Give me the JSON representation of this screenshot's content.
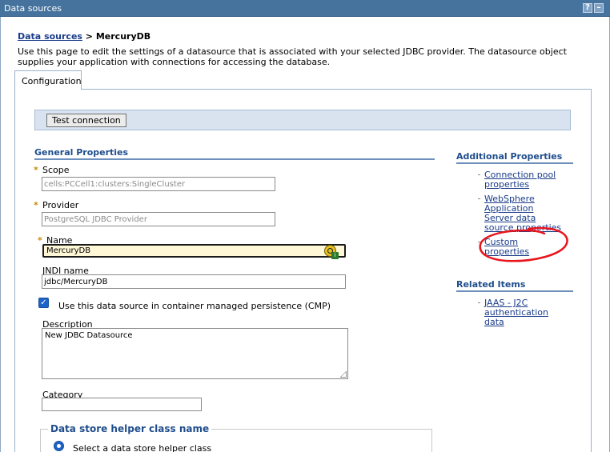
{
  "window": {
    "title": "Data sources",
    "help_label": "?",
    "minimize_label": "–"
  },
  "breadcrumb": {
    "parent": "Data sources",
    "separator": " > ",
    "current": "MercuryDB"
  },
  "description": "Use this page to edit the settings of a datasource that is associated with your selected JDBC provider. The datasource object supplies your application with connections for accessing the database.",
  "tabs": [
    {
      "label": "Configuration",
      "active": true
    }
  ],
  "toolbar": {
    "test_connection_label": "Test connection"
  },
  "general_properties": {
    "heading": "General Properties",
    "required_marker": "*",
    "scope": {
      "label": "Scope",
      "value": "cells:PCCell1:clusters:SingleCluster"
    },
    "provider": {
      "label": "Provider",
      "value": "PostgreSQL JDBC Provider"
    },
    "name": {
      "label": "Name",
      "value": "MercuryDB"
    },
    "jndi": {
      "label": "JNDI name",
      "value": "jdbc/MercuryDB"
    },
    "cmp": {
      "checked": true,
      "label": "Use this data source in container managed persistence (CMP)"
    },
    "description_field": {
      "label": "Description",
      "value": "New JDBC Datasource"
    },
    "category": {
      "label": "Category",
      "value": ""
    }
  },
  "helper_class": {
    "legend": "Data store helper class name",
    "option_label": "Select a data store helper class"
  },
  "additional_properties": {
    "heading": "Additional Properties",
    "links": [
      {
        "label": "Connection pool properties"
      },
      {
        "label": "WebSphere Application Server data source properties"
      },
      {
        "label": "Custom properties"
      }
    ]
  },
  "related_items": {
    "heading": "Related Items",
    "links": [
      {
        "label": "JAAS - J2C authentication data"
      }
    ]
  },
  "colors": {
    "titlebar": "#45739d",
    "accent_heading": "#1f4d8c",
    "link": "#1a3c8a",
    "annotation": "#e8141c",
    "required": "#c98a00"
  }
}
